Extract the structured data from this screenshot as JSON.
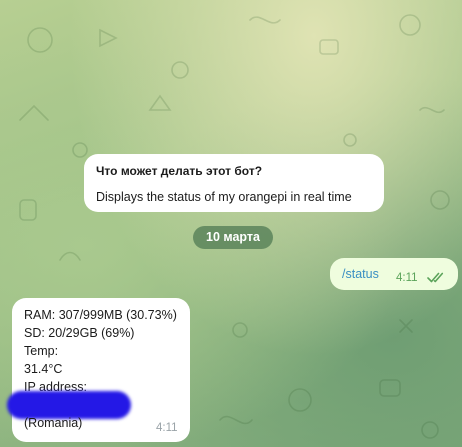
{
  "bot_info": {
    "title": "Что может делать этот бот?",
    "description": "Displays the status of my orangepi in real time"
  },
  "date_badge": "10 марта",
  "outgoing_message": {
    "text": "/status",
    "time": "4:11",
    "status_icon": "double-check-icon"
  },
  "incoming_message": {
    "lines": [
      "RAM: 307/999MB (30.73%)",
      "SD: 20/29GB (69%)",
      "Temp:",
      "31.4°C",
      "IP address:",
      " (Romania)"
    ],
    "time": "4:11"
  },
  "colors": {
    "outgoing_bubble": "#effdde",
    "incoming_bubble": "#ffffff",
    "link_blue": "#3a8fc3",
    "tick_green": "#5ba35a",
    "redaction": "#2418e6"
  }
}
